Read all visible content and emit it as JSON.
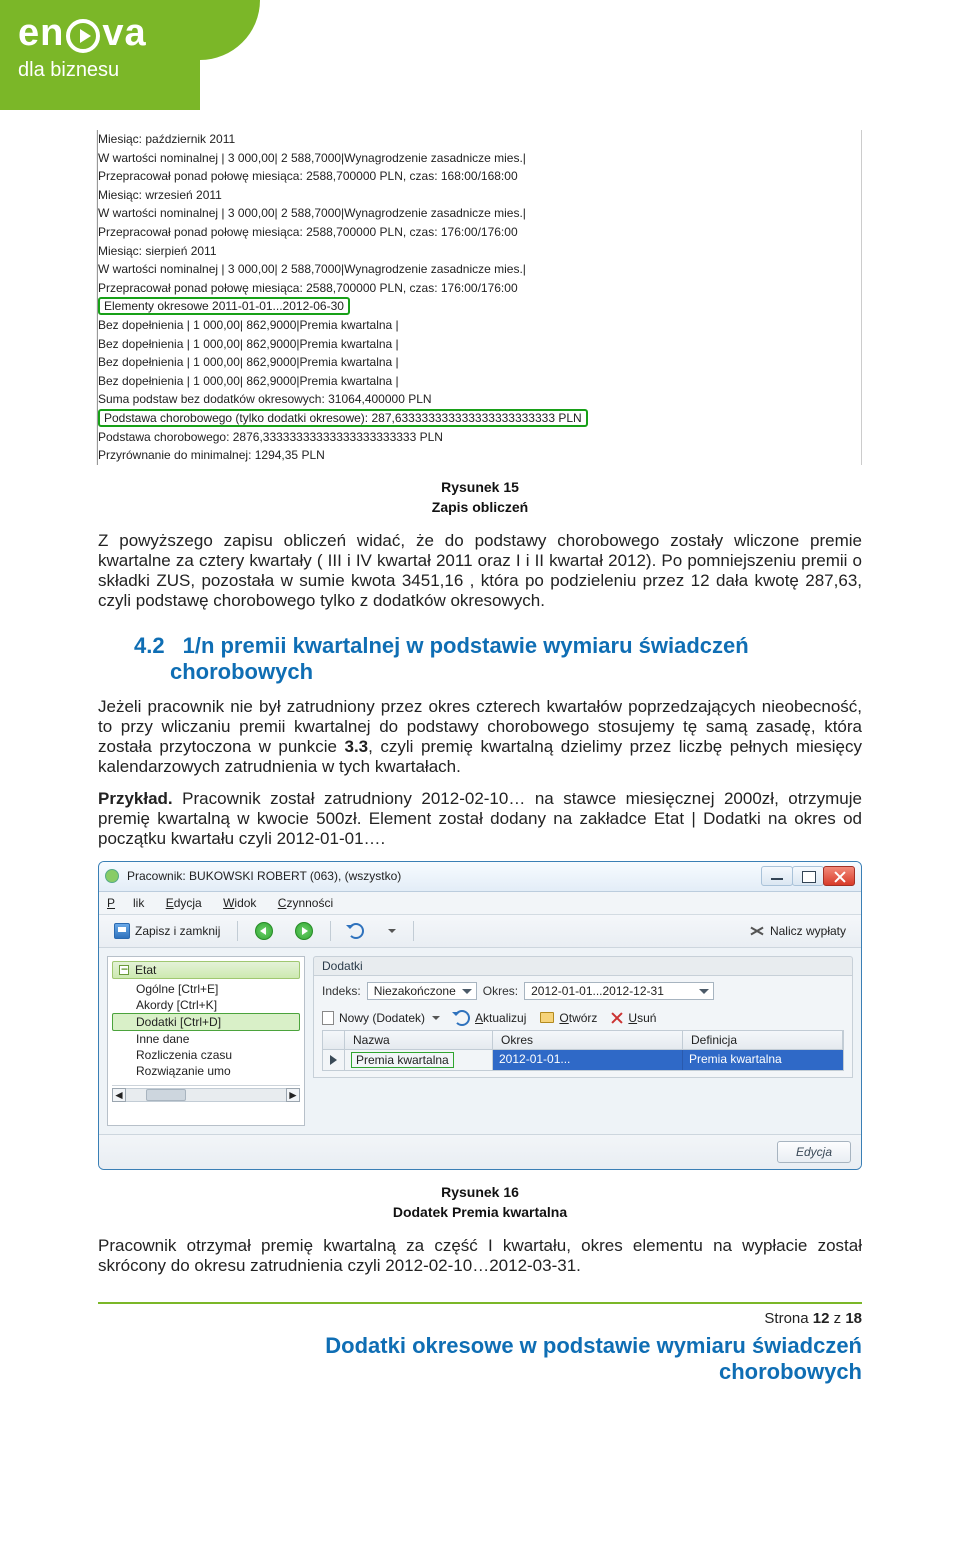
{
  "brand": {
    "logo_left": "en",
    "logo_right": "va",
    "tagline": "dla biznesu"
  },
  "log": {
    "l1": "Miesiąc: październik 2011",
    "l2": "W wartości nominalnej |          3 000,00|        2 588,7000|Wynagrodzenie zasadnicze mies.|",
    "l3": "Przepracował ponad połowę miesiąca: 2588,700000 PLN, czas: 168:00/168:00",
    "l4": "Miesiąc: wrzesień 2011",
    "l5": "W wartości nominalnej |          3 000,00|        2 588,7000|Wynagrodzenie zasadnicze mies.|",
    "l6": "Przepracował ponad połowę miesiąca: 2588,700000 PLN, czas: 176:00/176:00",
    "l7": "Miesiąc: sierpień 2011",
    "l8": "W wartości nominalnej |          3 000,00|        2 588,7000|Wynagrodzenie zasadnicze mies.|",
    "l9": "Przepracował ponad połowę miesiąca: 2588,700000 PLN, czas: 176:00/176:00",
    "lE": "Elementy okresowe 2011-01-01...2012-06-30",
    "lDa": "Bez dopełnienia        |          1 000,00|          862,9000|Premia kwartalna             |",
    "lDb": "Bez dopełnienia        |          1 000,00|          862,9000|Premia kwartalna             |",
    "lDc": "Bez dopełnienia        |          1 000,00|          862,9000|Premia kwartalna             |",
    "lDd": "Bez dopełnienia        |          1 000,00|          862,9000|Premia kwartalna             |",
    "lS1": "Suma podstaw bez dodatków okresowych:           31064,400000 PLN",
    "lS2": "Podstawa chorobowego (tylko dodatki okresowe):  287,633333333333333333333333 PLN",
    "lS3": "Podstawa chorobowego:                           2876,33333333333333333333333 PLN",
    "lS4": "Przyrównanie do minimalnej: 1294,35 PLN"
  },
  "fig15": {
    "num": "Rysunek 15",
    "title": "Zapis obliczeń"
  },
  "p1": "Z powyższego zapisu obliczeń widać, że do podstawy chorobowego zostały wliczone premie kwartalne za cztery kwartały ( III i IV kwartał 2011 oraz I i II kwartał 2012). Po pomniejszeniu premii o składki ZUS, pozostała w sumie kwota 3451,16 , która po podzieleniu przez 12 dała kwotę 287,63, czyli podstawę chorobowego tylko z dodatków okresowych.",
  "sec42": {
    "num": "4.2",
    "title": "1/n premii kwartalnej w podstawie wymiaru świadczeń chorobowych"
  },
  "p2": "Jeżeli pracownik nie był zatrudniony przez okres czterech kwartałów poprzedzających nieobecność, to przy wliczaniu premii kwartalnej do podstawy chorobowego stosujemy tę samą zasadę, która została przytoczona w punkcie ",
  "p2b": "3.3",
  "p2c": ", czyli premię kwartalną dzielimy przez liczbę pełnych miesięcy kalendarzowych zatrudnienia w tych kwartałach.",
  "p3a": "Przykład.",
  "p3b": " Pracownik został zatrudniony 2012-02-10… na stawce miesięcznej 2000zł, otrzymuje premię kwartalną w kwocie 500zł. Element został dodany na zakładce Etat | Dodatki na okres od początku kwartału czyli 2012-01-01….",
  "win": {
    "title": "Pracownik: BUKOWSKI ROBERT (063), (wszystko)",
    "menu": {
      "file": "Plik",
      "edit": "Edycja",
      "view": "Widok",
      "actions": "Czynności"
    },
    "toolbar": {
      "save_close": "Zapisz i zamknij",
      "calc": "Nalicz wypłaty"
    },
    "tree": {
      "root": "Etat",
      "i1": "Ogólne [Ctrl+E]",
      "i2": "Akordy [Ctrl+K]",
      "i3": "Dodatki [Ctrl+D]",
      "i4": "Inne dane",
      "i5": "Rozliczenia czasu",
      "i6": "Rozwiązanie umo"
    },
    "panel_title": "Dodatki",
    "filters": {
      "idx_label": "Indeks:",
      "idx_value": "Niezakończone",
      "period_label": "Okres:",
      "period_value": "2012-01-01...2012-12-31"
    },
    "actions": {
      "new_label": "Nowy (Dodatek)",
      "refresh": "Aktualizuj",
      "open": "Otwórz",
      "delete": "Usuń"
    },
    "grid": {
      "c1": "Nazwa",
      "c2": "Okres",
      "c3": "Definicja",
      "r1_name": "Premia kwartalna",
      "r1_period": "2012-01-01...",
      "r1_def": "Premia kwartalna"
    },
    "footer_btn": "Edycja"
  },
  "fig16": {
    "num": "Rysunek 16",
    "title": "Dodatek Premia kwartalna"
  },
  "p4": "Pracownik otrzymał premię kwartalną za część I kwartału, okres elementu na wypłacie został skrócony do okresu zatrudnienia czyli 2012-02-10…2012-03-31.",
  "footer": {
    "page_label": "Strona ",
    "page_num": "12",
    "page_of": " z ",
    "page_total": "18",
    "doc_title_l1": "Dodatki okresowe w podstawie wymiaru świadczeń",
    "doc_title_l2": "chorobowych"
  }
}
